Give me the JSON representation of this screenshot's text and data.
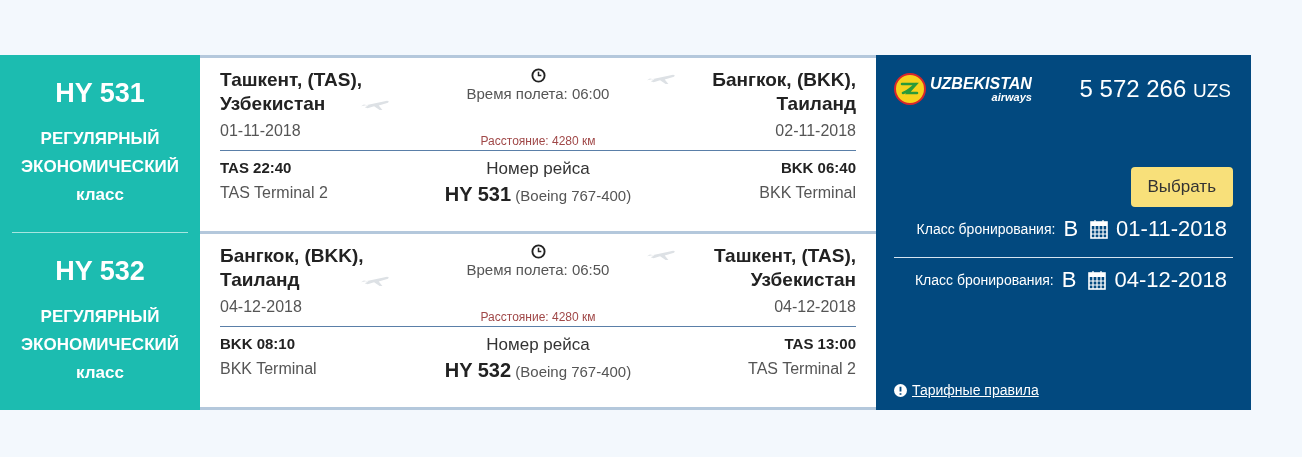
{
  "segments": [
    {
      "flight": "HY 531",
      "fare_class": "РЕГУЛЯРНЫЙ ЭКОНОМИЧЕСКИЙ класс",
      "origin": {
        "city": "Ташкент, (TAS), Узбекистан",
        "date": "01-11-2018",
        "time": "TAS 22:40",
        "terminal": "TAS Terminal 2"
      },
      "destination": {
        "city": "Бангкок, (BKK), Таиланд",
        "date": "02-11-2018",
        "time": "BKK 06:40",
        "terminal": "BKK Terminal"
      },
      "duration": "Время полета: 06:00",
      "distance": "Расстояние: 4280 км",
      "flight_label": "Номер рейса",
      "flight_number": "HY 531",
      "aircraft": "(Boeing 767-400)"
    },
    {
      "flight": "HY 532",
      "fare_class": "РЕГУЛЯРНЫЙ ЭКОНОМИЧЕСКИЙ класс",
      "origin": {
        "city": "Бангкок, (BKK), Таиланд",
        "date": "04-12-2018",
        "time": "BKK 08:10",
        "terminal": "BKK Terminal"
      },
      "destination": {
        "city": "Ташкент, (TAS), Узбекистан",
        "date": "04-12-2018",
        "time": "TAS 13:00",
        "terminal": "TAS Terminal 2"
      },
      "duration": "Время полета: 06:50",
      "distance": "Расстояние: 4280 км",
      "flight_label": "Номер рейса",
      "flight_number": "HY 532",
      "aircraft": "(Boeing 767-400)"
    }
  ],
  "offer": {
    "logo": {
      "name": "UZBEKISTAN",
      "sub": "airways"
    },
    "price": "5 572 266",
    "currency": "UZS",
    "select_button": "Выбрать",
    "bookings": [
      {
        "label": "Класс бронирования:",
        "class": "B",
        "date": "01-11-2018"
      },
      {
        "label": "Класс бронирования:",
        "class": "B",
        "date": "04-12-2018"
      }
    ],
    "rules_link": "Тарифные правила"
  }
}
